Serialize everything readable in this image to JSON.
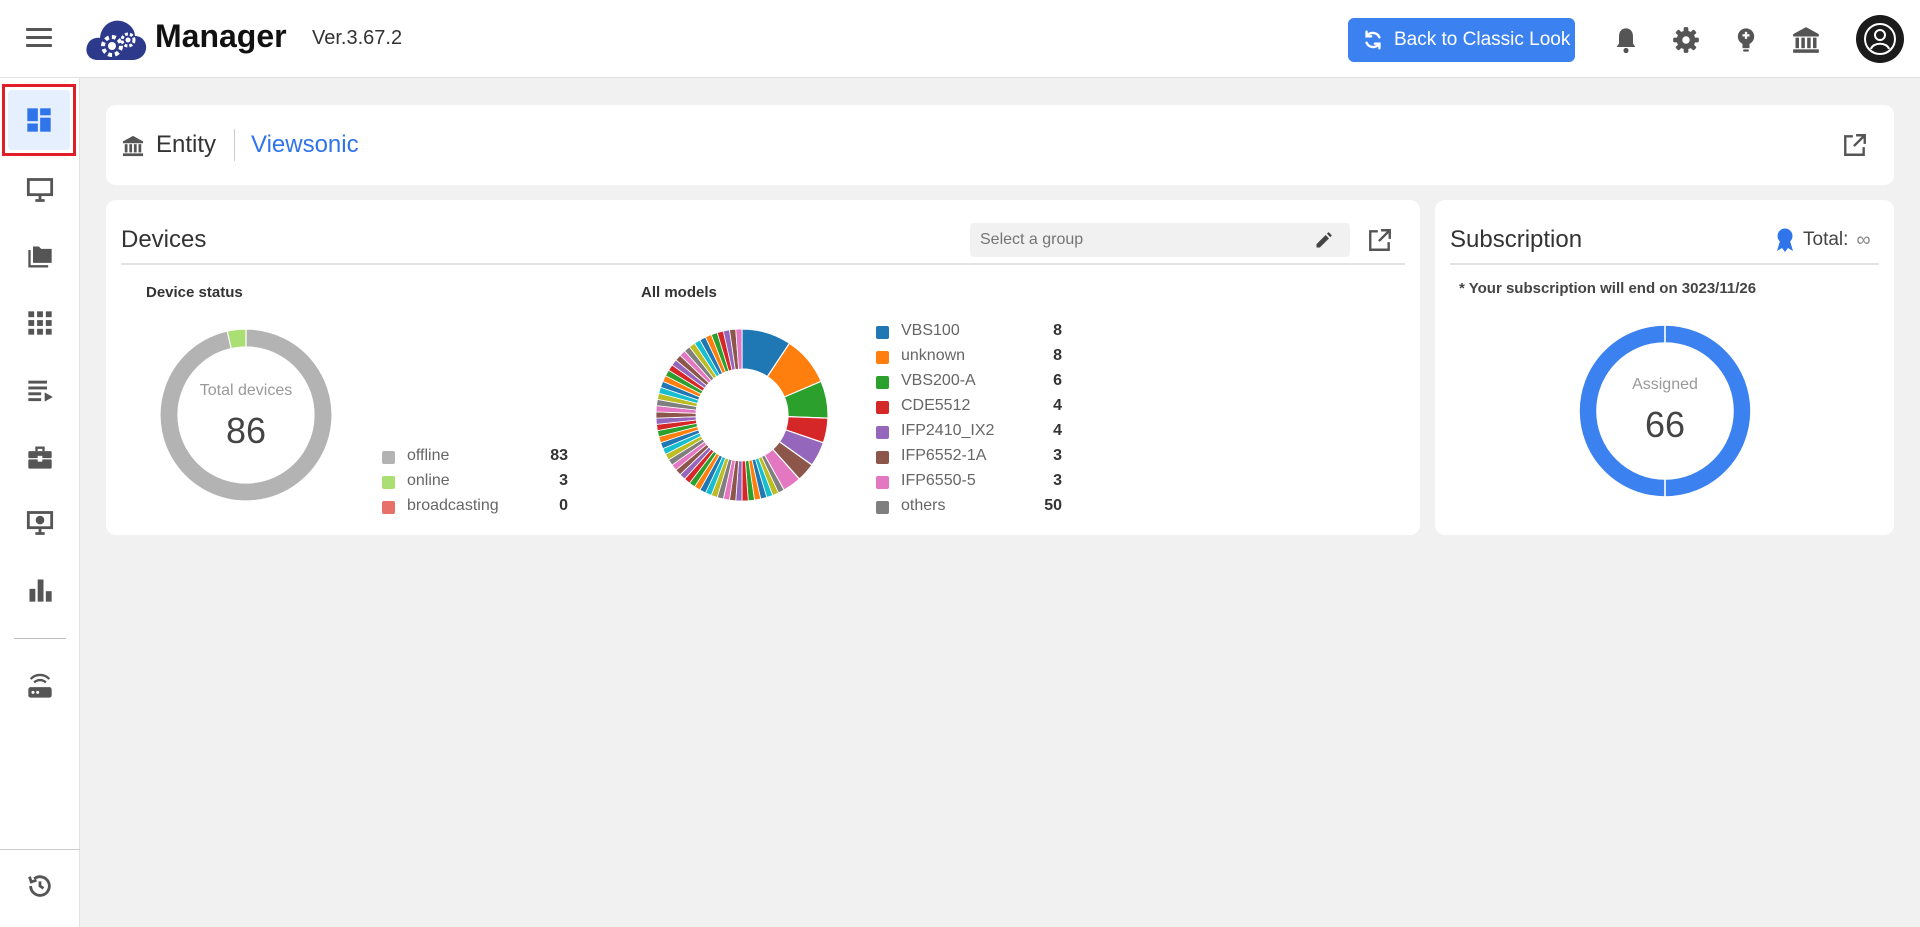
{
  "header": {
    "app_name": "Manager",
    "version": "Ver.3.67.2",
    "classic_button_label": "Back to Classic Look",
    "icons": [
      "menu-icon",
      "bell-icon",
      "gear-icon",
      "lightbulb-icon",
      "institution-icon",
      "user-avatar"
    ]
  },
  "sidebar": {
    "items": [
      {
        "icon": "dashboard-icon",
        "active": true
      },
      {
        "icon": "monitor-icon"
      },
      {
        "icon": "folder-icon"
      },
      {
        "icon": "apps-grid-icon"
      },
      {
        "icon": "playlist-icon"
      },
      {
        "icon": "toolbox-icon"
      },
      {
        "icon": "screen-settings-icon"
      },
      {
        "icon": "bar-chart-icon"
      },
      {
        "icon": "router-icon"
      },
      {
        "icon": "history-icon"
      }
    ]
  },
  "entity": {
    "label": "Entity",
    "value": "Viewsonic"
  },
  "devices": {
    "title": "Devices",
    "group_placeholder": "Select a group",
    "status_title": "Device status",
    "center_label": "Total devices",
    "total": "86",
    "models_title": "All models"
  },
  "subscription": {
    "title": "Subscription",
    "total_label": "Total:",
    "total_value": "∞",
    "note_prefix": "* Your subscription will end on ",
    "note_date": "3023/11/26",
    "center_label": "Assigned",
    "assigned": "66"
  },
  "colors": {
    "accent": "#3b82f0",
    "offline": "#b3b3b3",
    "online": "#a9df73",
    "broadcasting": "#e8706b",
    "subscription_ring": "#3b82f0"
  },
  "chart_data": [
    {
      "type": "pie",
      "title": "Device status",
      "center_label": "Total devices",
      "categories": [
        "offline",
        "online",
        "broadcasting"
      ],
      "values": [
        83,
        3,
        0
      ],
      "colors": [
        "#b3b3b3",
        "#a9df73",
        "#e8706b"
      ]
    },
    {
      "type": "pie",
      "title": "All models",
      "categories": [
        "VBS100",
        "unknown",
        "VBS200-A",
        "CDE5512",
        "IFP2410_IX2",
        "IFP6552-1A",
        "IFP6550-5",
        "others"
      ],
      "values": [
        8,
        8,
        6,
        4,
        4,
        3,
        3,
        50
      ],
      "colors": [
        "#1f77b4",
        "#ff7f0e",
        "#2ca02c",
        "#d62728",
        "#9467bd",
        "#8c564b",
        "#e377c2",
        "#7f7f7f"
      ]
    },
    {
      "type": "pie",
      "title": "Subscription",
      "center_label": "Assigned",
      "values": [
        66
      ]
    }
  ]
}
